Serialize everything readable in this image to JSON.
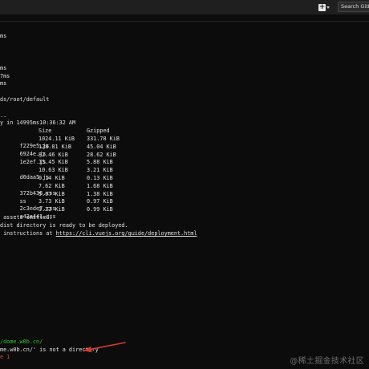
{
  "header": {
    "search_label": "Search GitLab",
    "plus_icon": "plus-icon",
    "caret_icon": "chevron-down-icon"
  },
  "terminal": {
    "lines_top": [
      "ms",
      "",
      "",
      "ms",
      "7ms",
      "ms",
      "",
      "ds/root/default",
      "",
      "..",
      "y in 14995ms10:36:32 AM"
    ],
    "table_header": {
      "name": "",
      "size": "Size",
      "gzipped": "Gzipped"
    },
    "table_rows": [
      {
        "name": "f229e5.js",
        "size": "1024.11 KiB",
        "gzipped": "331.78 KiB"
      },
      {
        "name": "6924e.js",
        "size": "128.81 KiB",
        "gzipped": "45.04 KiB"
      },
      {
        "name": "1e2ef.js",
        "size": "82.46 KiB",
        "gzipped": "28.62 KiB"
      },
      {
        "name": "",
        "size": "15.45 KiB",
        "gzipped": "5.88 KiB"
      },
      {
        "name": "d0daa5.js",
        "size": "10.63 KiB",
        "gzipped": "3.21 KiB"
      },
      {
        "name": "",
        "size": "0.14 KiB",
        "gzipped": "0.13 KiB"
      },
      {
        "name": "372b436.css",
        "size": "7.62 KiB",
        "gzipped": "1.68 KiB"
      },
      {
        "name": "ss",
        "size": "5.07 KiB",
        "gzipped": "1.38 KiB"
      },
      {
        "name": "2c3ede7.css",
        "size": "3.73 KiB",
        "gzipped": "0.97 KiB"
      },
      {
        "name": "a42a441.css",
        "size": "3.22 KiB",
        "gzipped": "0.99 KiB"
      }
    ],
    "omitted": " assets omitted.",
    "ready": "dist directory is ready to be deployed.",
    "instructions_prefix": " instructions at ",
    "instructions_link": "https://cli.vuejs.org/guide/deployment.html",
    "path_line": "/dome.w0b.cn/",
    "error_line": "me.w0b.cn/' is not a directory",
    "exit_line": "e 1"
  },
  "watermark": "@稀土掘金技术社区",
  "colors": {
    "background": "#0c0c0c",
    "text": "#e2e2e2",
    "path_green": "#35c235",
    "error_red": "#e0443a",
    "arrow_red": "#d63a2f"
  }
}
